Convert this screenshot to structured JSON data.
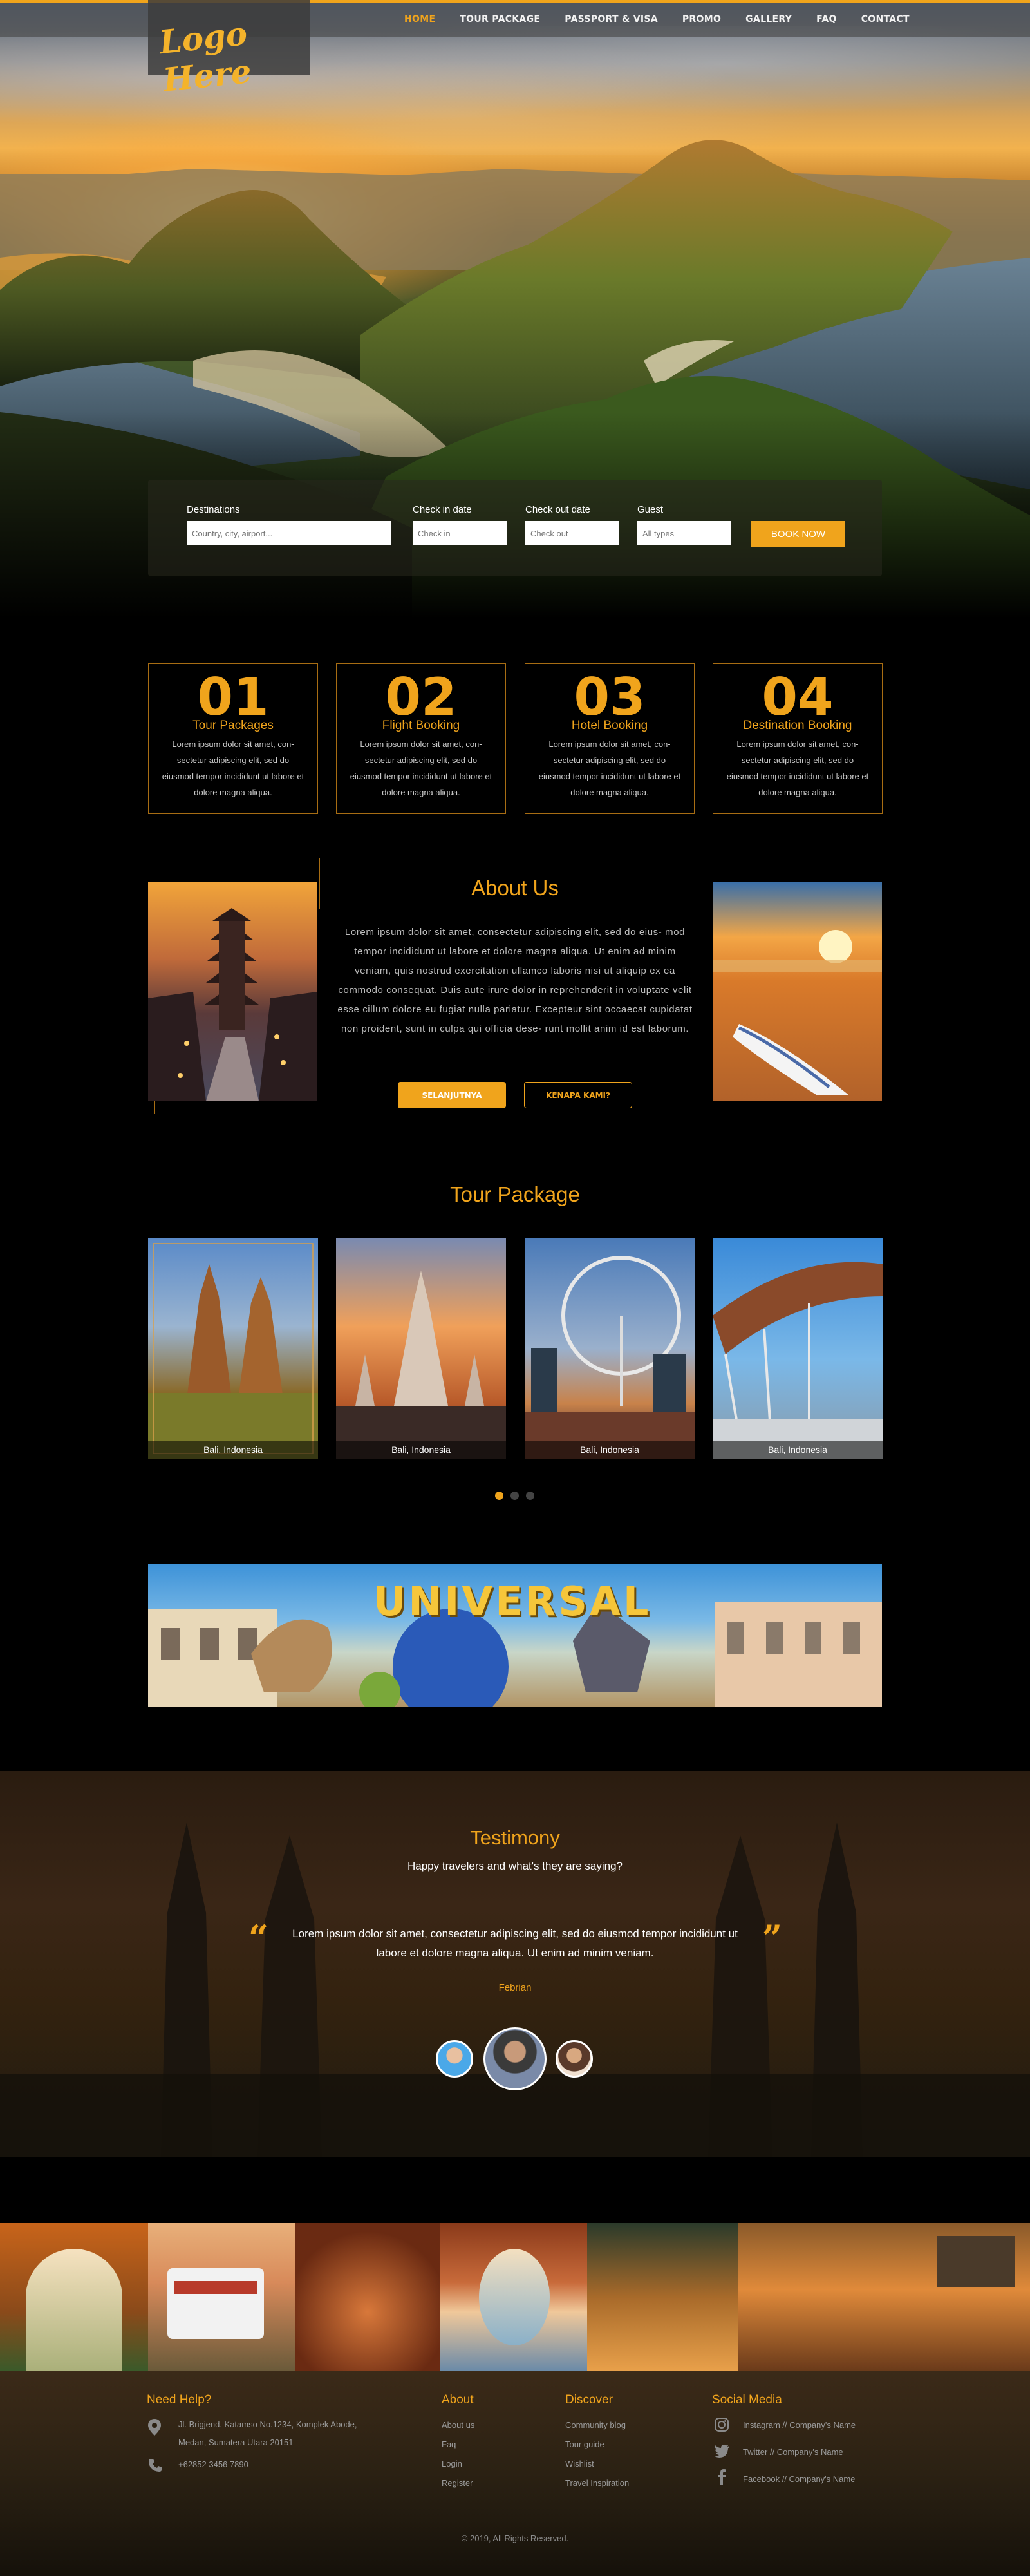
{
  "header": {
    "logo_text": "Logo Here",
    "nav": [
      "HOME",
      "TOUR PACKAGE",
      "PASSPORT & VISA",
      "PROMO",
      "GALLERY",
      "FAQ",
      "CONTACT"
    ]
  },
  "search": {
    "destinations_label": "Destinations",
    "destinations_placeholder": "Country, city, airport...",
    "checkin_label": "Check in date",
    "checkin_placeholder": "Check in",
    "checkout_label": "Check out date",
    "checkout_placeholder": "Check out",
    "guest_label": "Guest",
    "guest_value": "All types",
    "book_button": "BOOK NOW"
  },
  "services": [
    {
      "num": "01",
      "title": "Tour Packages",
      "desc": "Lorem ipsum dolor sit amet, con- sectetur adipiscing elit, sed do eiusmod tempor incididunt ut labore et dolore magna aliqua."
    },
    {
      "num": "02",
      "title": "Flight Booking",
      "desc": "Lorem ipsum dolor sit amet, con- sectetur adipiscing elit, sed do eiusmod tempor incididunt ut labore et dolore magna aliqua."
    },
    {
      "num": "03",
      "title": "Hotel Booking",
      "desc": "Lorem ipsum dolor sit amet, con- sectetur adipiscing elit, sed do eiusmod tempor incididunt ut labore et dolore magna aliqua."
    },
    {
      "num": "04",
      "title": "Destination Booking",
      "desc": "Lorem ipsum dolor sit amet, con- sectetur adipiscing elit, sed do eiusmod tempor incididunt ut labore et dolore magna aliqua."
    }
  ],
  "about": {
    "title": "About Us",
    "text": "Lorem ipsum dolor sit amet, consectetur adipiscing elit, sed do eius- mod tempor incididunt ut labore et dolore magna aliqua. Ut enim ad minim veniam, quis nostrud exercitation ullamco laboris nisi ut aliquip ex ea commodo consequat. Duis aute irure dolor in reprehenderit in voluptate velit esse cillum dolore eu fugiat nulla pariatur. Excepteur sint occaecat cupidatat non proident, sunt in culpa qui officia dese- runt mollit anim id est laborum.",
    "primary_button": "SELANJUTNYA",
    "secondary_button": "KENAPA KAMI?"
  },
  "tour": {
    "title": "Tour Package",
    "cards": [
      {
        "caption": "Bali, Indonesia"
      },
      {
        "caption": "Bali, Indonesia"
      },
      {
        "caption": "Bali, Indonesia"
      },
      {
        "caption": "Bali, Indonesia"
      }
    ],
    "active_dot": 0
  },
  "banner": {
    "brand_text": "UNIVERSAL"
  },
  "testimony": {
    "title": "Testimony",
    "subtitle": "Happy travelers and what's they are saying?",
    "quote": "Lorem ipsum dolor sit amet, consectetur adipiscing elit, sed do eiusmod tempor incididunt ut labore et dolore magna aliqua. Ut enim ad minim veniam.",
    "name": "Febrian"
  },
  "footer": {
    "help_title": "Need Help?",
    "address_line1": "Jl. Brigjend. Katamso No.1234, Komplek Abode,",
    "address_line2": "Medan, Sumatera Utara 20151",
    "phone": "+62852 3456 7890",
    "about_title": "About",
    "about_links": [
      "About us",
      "Faq",
      "Login",
      "Register"
    ],
    "discover_title": "Discover",
    "discover_links": [
      "Community blog",
      "Tour guide",
      "Wishlist",
      "Travel Inspiration"
    ],
    "social_title": "Social Media",
    "social_links": [
      "Instagram // Company's Name",
      "Twitter // Company's Name",
      "Facebook // Company's Name"
    ],
    "copyright": "© 2019, All Rights Reserved."
  },
  "colors": {
    "accent": "#f0a41c",
    "background": "#000000"
  },
  "icons": [
    "location-pin-icon",
    "phone-icon",
    "instagram-icon",
    "twitter-icon",
    "facebook-icon",
    "quote-open-icon",
    "quote-close-icon"
  ]
}
